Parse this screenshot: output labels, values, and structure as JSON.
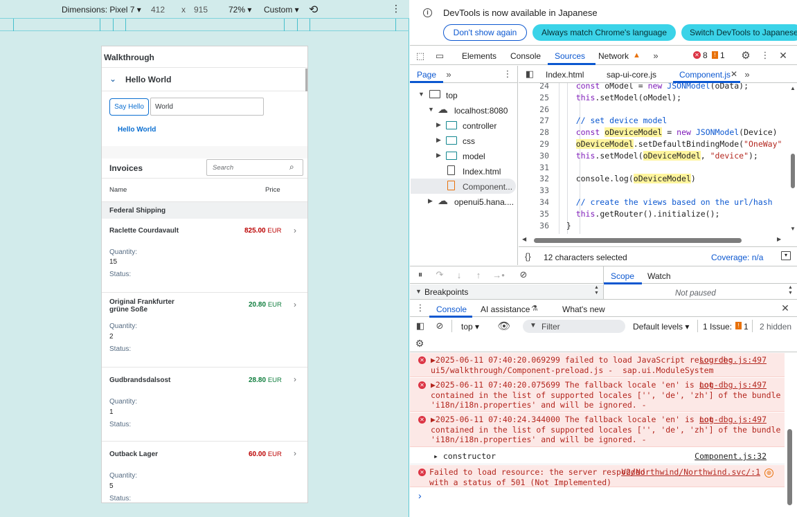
{
  "device_toolbar": {
    "dimensions_label": "Dimensions: Pixel 7",
    "width": "412",
    "height_sep": "x",
    "height": "915",
    "zoom": "72%",
    "throttle": "Custom"
  },
  "app": {
    "title": "Walkthrough",
    "panel_title": "Hello World",
    "say_hello_label": "Say Hello",
    "input_value": "World",
    "hello_text": "Hello World",
    "invoices_title": "Invoices",
    "search_placeholder": "Search",
    "col_name": "Name",
    "col_price": "Price",
    "group_header": "Federal Shipping",
    "qty_label": "Quantity:",
    "status_label": "Status:",
    "items": [
      {
        "name": "Raclette Courdavault",
        "price": "825.00",
        "currency": "EUR",
        "qty": "15",
        "color": "#bb0000"
      },
      {
        "name": "Original Frankfurter grüne Soße",
        "price": "20.80",
        "currency": "EUR",
        "qty": "2",
        "color": "#107e3e"
      },
      {
        "name": "Gudbrandsdalsost",
        "price": "28.80",
        "currency": "EUR",
        "qty": "1",
        "color": "#107e3e"
      },
      {
        "name": "Outback Lager",
        "price": "60.00",
        "currency": "EUR",
        "qty": "5",
        "color": "#bb0000"
      }
    ]
  },
  "devtools": {
    "banner_text": "DevTools is now available in Japanese",
    "btn_dont_show": "Don't show again",
    "btn_match": "Always match Chrome's language",
    "btn_switch": "Switch DevTools to Japanese",
    "tabs": [
      "Elements",
      "Console",
      "Sources",
      "Network"
    ],
    "error_count": "8",
    "warning_count": "1",
    "page_tab": "Page",
    "file_tabs": [
      "Index.html",
      "sap-ui-core.js",
      "Component.js"
    ],
    "tree": {
      "top": "top",
      "host": "localhost:8080",
      "folders": [
        "controller",
        "css",
        "model"
      ],
      "files": [
        "Index.html",
        "Component..."
      ],
      "remote": "openui5.hana...."
    },
    "code": [
      {
        "n": "24",
        "t": "    const oModel = new JSONModel(oData);"
      },
      {
        "n": "25",
        "t": "    this.setModel(oModel);"
      },
      {
        "n": "26",
        "t": ""
      },
      {
        "n": "27",
        "t": "    // set device model"
      },
      {
        "n": "28",
        "t": "    const oDeviceModel = new JSONModel(Device)"
      },
      {
        "n": "29",
        "t": "    oDeviceModel.setDefaultBindingMode(\"OneWay\""
      },
      {
        "n": "30",
        "t": "    this.setModel(oDeviceModel, \"device\");"
      },
      {
        "n": "31",
        "t": ""
      },
      {
        "n": "32",
        "t": "    console.log(oDeviceModel)"
      },
      {
        "n": "33",
        "t": ""
      },
      {
        "n": "34",
        "t": "    // create the views based on the url/hash"
      },
      {
        "n": "35",
        "t": "    this.getRouter().initialize();"
      },
      {
        "n": "36",
        "t": "  }"
      }
    ],
    "selection_status": "12 characters selected",
    "coverage": "Coverage: n/a",
    "breakpoints": "Breakpoints",
    "scope_tab": "Scope",
    "watch_tab": "Watch",
    "not_paused": "Not paused",
    "drawer_tabs": [
      "Console",
      "AI assistance",
      "What's new"
    ],
    "context": "top",
    "filter_placeholder": "Filter",
    "levels": "Default levels",
    "issues_label": "1 Issue:",
    "issues_count": "1",
    "hidden": "2 hidden",
    "messages": [
      {
        "text": "▶2025-06-11 07:40:20.069299 failed to load JavaScript resource:\nui5/walkthrough/Component-preload.js -  sap.ui.ModuleSystem",
        "link": "Log-dbg.js:497"
      },
      {
        "text": "▶2025-06-11 07:40:20.075699 The fallback locale 'en' is not\ncontained in the list of supported locales ['', 'de', 'zh'] of the bundle\n'i18n/i18n.properties' and will be ignored. -",
        "link": "Log-dbg.js:497"
      },
      {
        "text": "▶2025-06-11 07:40:24.344000 The fallback locale 'en' is not\ncontained in the list of supported locales ['', 'de', 'zh'] of the bundle\n'i18n/i18n.properties' and will be ignored. -",
        "link": "Log-dbg.js:497"
      }
    ],
    "log_constructor": "▸ constructor",
    "log_constructor_link": "Component.js:32",
    "net_error": "Failed to load resource: the server responded\nwith a status of 501 (Not Implemented)",
    "net_error_link": "V2/Northwind/Northwind.svc/:1",
    "prompt": "›"
  },
  "colors": {
    "accent": "#0b57d0",
    "error_bg": "#fce8e6",
    "error_text": "#b3261e",
    "device_bg": "#d2ebeb",
    "cyan_button": "#3bd3e8"
  }
}
